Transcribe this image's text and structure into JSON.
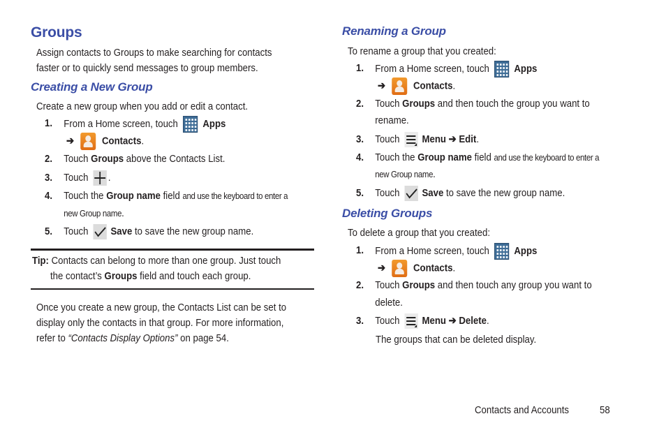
{
  "page": {
    "title": "Groups",
    "intro": "Assign contacts to Groups to make searching for contacts faster or to quickly send messages to group members.",
    "intro_lines": [
      "Assign contacts to Groups to make searching for contacts",
      "faster or to quickly send messages to group members."
    ],
    "footer": {
      "section": "Contacts and Accounts",
      "page_number": "58"
    }
  },
  "creating": {
    "heading": "Creating a New Group",
    "intro": "Create a new group when you add or edit a contact.",
    "steps": [
      {
        "num": "1.",
        "pre": "From a Home screen, touch",
        "apps_label": "Apps",
        "arrow": "➔",
        "contacts_label": "Contacts",
        "end": "."
      },
      {
        "num": "2.",
        "pre": "Touch",
        "bold": "Groups",
        "post": "above the Contacts List."
      },
      {
        "num": "3.",
        "pre": "Touch",
        "end": "."
      },
      {
        "num": "4.",
        "pre": "Touch the",
        "bold": "Group name",
        "mid": "field",
        "small1": "and use the keyboard to enter a",
        "small2": "new Group name",
        "end": "."
      },
      {
        "num": "5.",
        "pre": "Touch",
        "bold": "Save",
        "post": "to save the new group name."
      }
    ]
  },
  "tip": {
    "label": "Tip:",
    "line1": "Contacts can belong to more than one group. Just touch",
    "line2_pre": "the contact’s",
    "line2_bold": "Groups",
    "line2_post": "field and touch each group."
  },
  "display_note": {
    "line1": "Once you create a new group, the Contacts List can be set to",
    "line2": "display only the contacts in that group. For more information,",
    "line3_pre": "refer to",
    "line3_link": "“Contacts Display Options”",
    "line3_post": "on page 54."
  },
  "renaming": {
    "heading": "Renaming a Group",
    "intro": "To rename a group that you created:",
    "steps": [
      {
        "num": "1.",
        "pre": "From a Home screen, touch",
        "apps_label": "Apps",
        "arrow": "➔",
        "contacts_label": "Contacts",
        "end": "."
      },
      {
        "num": "2.",
        "pre": "Touch",
        "bold": "Groups",
        "post": "and then touch the group you want to",
        "line2": "rename."
      },
      {
        "num": "3.",
        "pre": "Touch",
        "menu_label": "Menu",
        "arrow": "➔",
        "action": "Edit",
        "end": "."
      },
      {
        "num": "4.",
        "pre": "Touch the",
        "bold": "Group name",
        "mid": "field",
        "small1": "and use the keyboard to enter a",
        "small2": "new Group name",
        "end": "."
      },
      {
        "num": "5.",
        "pre": "Touch",
        "bold": "Save",
        "post": "to save the new group name."
      }
    ]
  },
  "deleting": {
    "heading": "Deleting Groups",
    "intro": "To delete a group that you created:",
    "steps": [
      {
        "num": "1.",
        "pre": "From a Home screen, touch",
        "apps_label": "Apps",
        "arrow": "➔",
        "contacts_label": "Contacts",
        "end": "."
      },
      {
        "num": "2.",
        "pre": "Touch",
        "bold": "Groups",
        "post": "and then touch any group you want to",
        "line2": "delete."
      },
      {
        "num": "3.",
        "pre": "Touch",
        "menu_label": "Menu",
        "arrow": "➔",
        "action": "Delete",
        "end": "."
      }
    ],
    "result": "The groups that can be deleted display."
  },
  "icons": {
    "apps": "apps-grid-icon",
    "contacts": "contacts-person-icon",
    "add": "plus-icon",
    "save": "checkmark-icon",
    "menu": "menu-icon"
  },
  "colors": {
    "heading": "#3b4ea6",
    "text": "#231f20",
    "apps_icon": "#3d6c96",
    "contacts_icon": "#e8801f"
  }
}
